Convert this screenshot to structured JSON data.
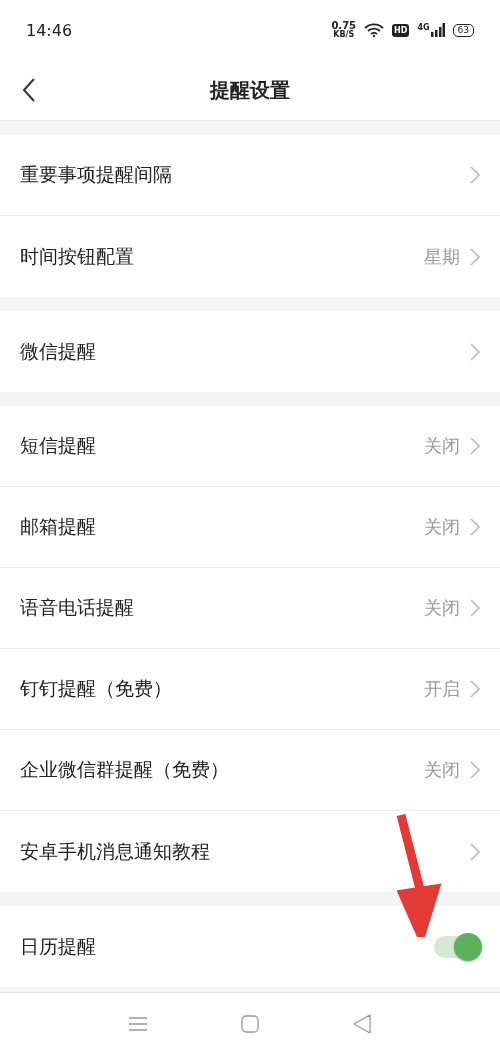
{
  "status_bar": {
    "time": "14:46",
    "speed": "0.75",
    "speed_unit": "KB/S",
    "hd": "HD",
    "network": "4G",
    "battery": "63"
  },
  "header": {
    "title": "提醒设置"
  },
  "sections": [
    {
      "items": [
        {
          "kind": "link",
          "label": "重要事项提醒间隔"
        },
        {
          "kind": "link",
          "label": "时间按钮配置",
          "value": "星期"
        }
      ]
    },
    {
      "items": [
        {
          "kind": "link",
          "label": "微信提醒"
        }
      ]
    },
    {
      "items": [
        {
          "kind": "link",
          "label": "短信提醒",
          "value": "关闭"
        },
        {
          "kind": "link",
          "label": "邮箱提醒",
          "value": "关闭"
        },
        {
          "kind": "link",
          "label": "语音电话提醒",
          "value": "关闭"
        },
        {
          "kind": "link",
          "label": "钉钉提醒（免费）",
          "value": "开启"
        },
        {
          "kind": "link",
          "label": "企业微信群提醒（免费）",
          "value": "关闭"
        },
        {
          "kind": "link",
          "label": "安卓手机消息通知教程"
        }
      ]
    },
    {
      "items": [
        {
          "kind": "toggle",
          "label": "日历提醒",
          "on": true
        }
      ]
    }
  ]
}
